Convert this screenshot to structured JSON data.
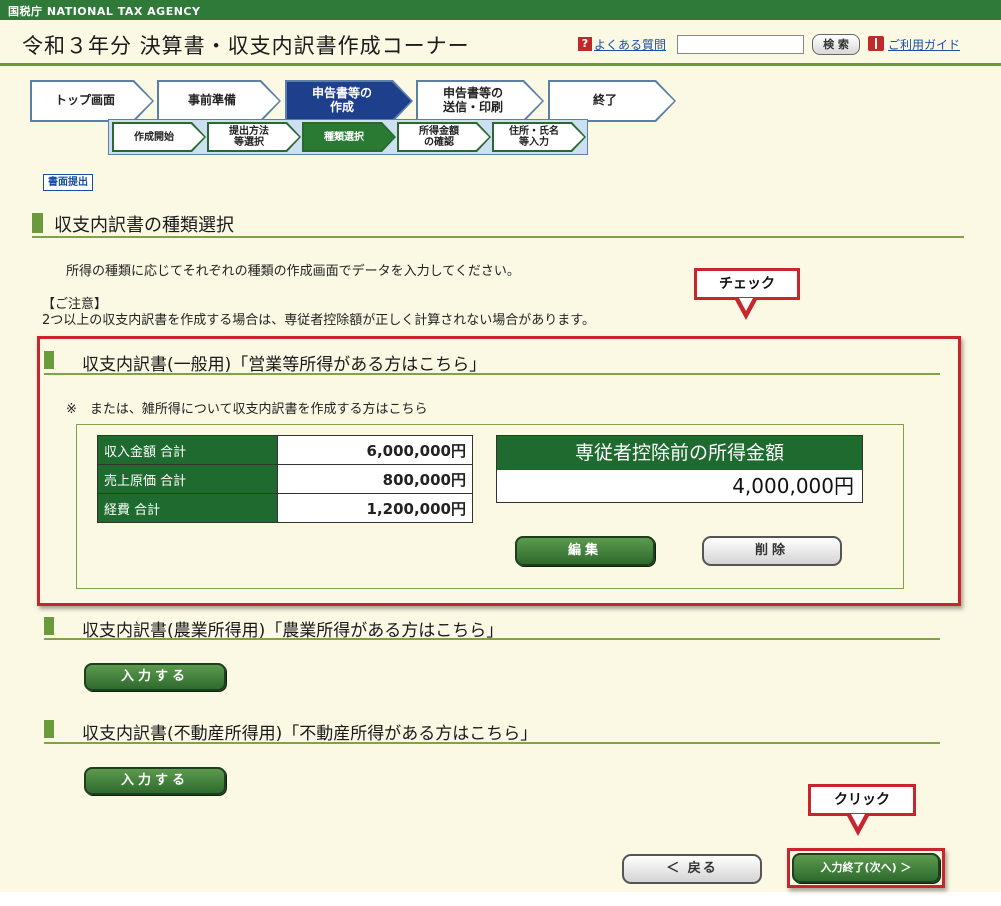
{
  "header": {
    "agency": "国税庁  NATIONAL TAX AGENCY",
    "title": "令和３年分 決算書・収支内訳書作成コーナー",
    "faq_icon": "?",
    "faq_link": "よくある質問",
    "search_placeholder": "",
    "search_button": "検 索",
    "guide_link": "ご利用ガイド"
  },
  "main_steps": [
    {
      "label": "トップ画面",
      "active": false
    },
    {
      "label": "事前準備",
      "active": false
    },
    {
      "label": "申告書等の\n作成",
      "active": true
    },
    {
      "label": "申告書等の\n送信・印刷",
      "active": false
    },
    {
      "label": "終了",
      "active": false
    }
  ],
  "sub_steps": [
    {
      "label": "作成開始",
      "active": false
    },
    {
      "label": "提出方法\n等選択",
      "active": false
    },
    {
      "label": "種類選択",
      "active": true
    },
    {
      "label": "所得金額\nの確認",
      "active": false
    },
    {
      "label": "住所・氏名\n等入力",
      "active": false
    }
  ],
  "submission_tag": "書面提出",
  "page_heading": "収支内訳書の種類選択",
  "intro_text": "所得の種類に応じてそれぞれの種類の作成画面でデータを入力してください。",
  "notice": {
    "title": "【ご注意】",
    "body": "2つ以上の収支内訳書を作成する場合は、専従者控除額が正しく計算されない場合があります。"
  },
  "callouts": {
    "check": "チェック",
    "click": "クリック"
  },
  "general_section": {
    "heading": "収支内訳書(一般用)「営業等所得がある方はこちら」",
    "note": "※　または、雑所得について収支内訳書を作成する方はこちら",
    "rows": [
      {
        "label": "収入金額 合計",
        "value": "6,000,000円"
      },
      {
        "label": "売上原価 合計",
        "value": "800,000円"
      },
      {
        "label": "経費 合計",
        "value": "1,200,000円"
      }
    ],
    "income_label": "専従者控除前の所得金額",
    "income_value": "4,000,000円",
    "edit_button": "編集",
    "delete_button": "削除"
  },
  "agri_section": {
    "heading": "収支内訳書(農業所得用)「農業所得がある方はこちら」",
    "button": "入力する"
  },
  "realestate_section": {
    "heading": "収支内訳書(不動産所得用)「不動産所得がある方はこちら」",
    "button": "入力する"
  },
  "footer": {
    "back_button": "＜ 戻る",
    "next_button": "入力終了(次へ) ＞"
  }
}
